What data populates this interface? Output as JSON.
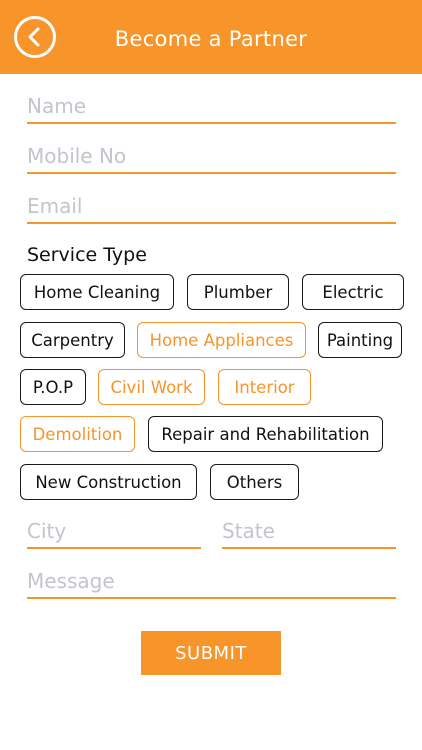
{
  "header": {
    "title": "Become a Partner",
    "back_icon": "chevron-left-icon"
  },
  "form": {
    "name_placeholder": "Name",
    "mobile_placeholder": "Mobile No",
    "email_placeholder": "Email",
    "service_type_label": "Service Type",
    "city_placeholder": "City",
    "state_placeholder": "State",
    "message_placeholder": "Message",
    "submit_label": "SUBMIT"
  },
  "services": [
    {
      "label": "Home Cleaning",
      "selected": false
    },
    {
      "label": "Plumber",
      "selected": false
    },
    {
      "label": "Electric",
      "selected": false
    },
    {
      "label": "Carpentry",
      "selected": false
    },
    {
      "label": "Home Appliances",
      "selected": true
    },
    {
      "label": "Painting",
      "selected": false
    },
    {
      "label": "P.O.P",
      "selected": false
    },
    {
      "label": "Civil Work",
      "selected": true
    },
    {
      "label": "Interior",
      "selected": true
    },
    {
      "label": "Demolition",
      "selected": true
    },
    {
      "label": "Repair and Rehabilitation",
      "selected": false
    },
    {
      "label": "New Construction",
      "selected": false
    },
    {
      "label": "Others",
      "selected": false
    }
  ],
  "colors": {
    "accent": "#f7942a",
    "chip_border": "#1a1a1a",
    "placeholder": "#c2c5cc"
  }
}
